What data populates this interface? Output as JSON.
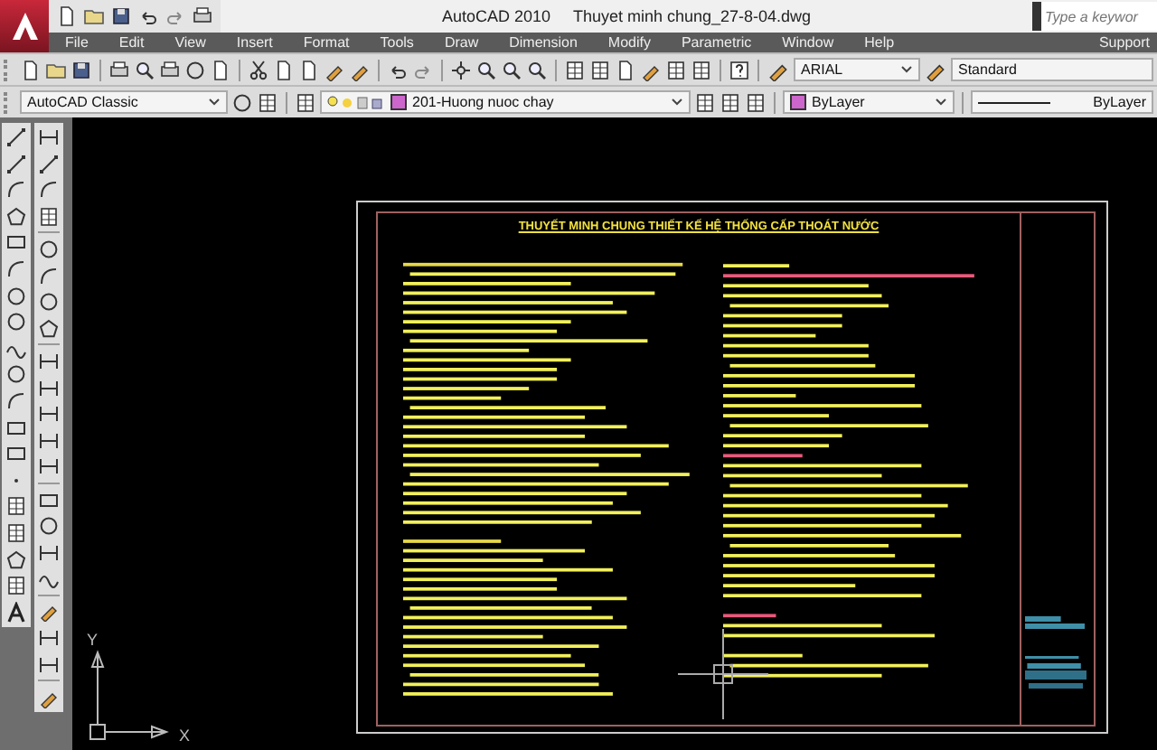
{
  "app": {
    "product": "AutoCAD 2010",
    "file": "Thuyet minh chung_27-8-04.dwg"
  },
  "search": {
    "placeholder": "Type a keywor"
  },
  "menu": [
    "File",
    "Edit",
    "View",
    "Insert",
    "Format",
    "Tools",
    "Draw",
    "Dimension",
    "Modify",
    "Parametric",
    "Window",
    "Help",
    "Support"
  ],
  "text_style": {
    "font": "ARIAL",
    "style": "Standard"
  },
  "workspace": "AutoCAD Classic",
  "layer": {
    "name": "201-Huong nuoc chay",
    "color": "#cc66cc"
  },
  "color_control": {
    "label": "ByLayer",
    "color": "#cc66cc"
  },
  "linetype": "ByLayer",
  "drawing": {
    "title": "THUYẾT MINH CHUNG THIẾT KẾ HỆ THỐNG CẤP THOÁT NƯỚC"
  },
  "ucs": {
    "x": "X",
    "y": "Y"
  }
}
